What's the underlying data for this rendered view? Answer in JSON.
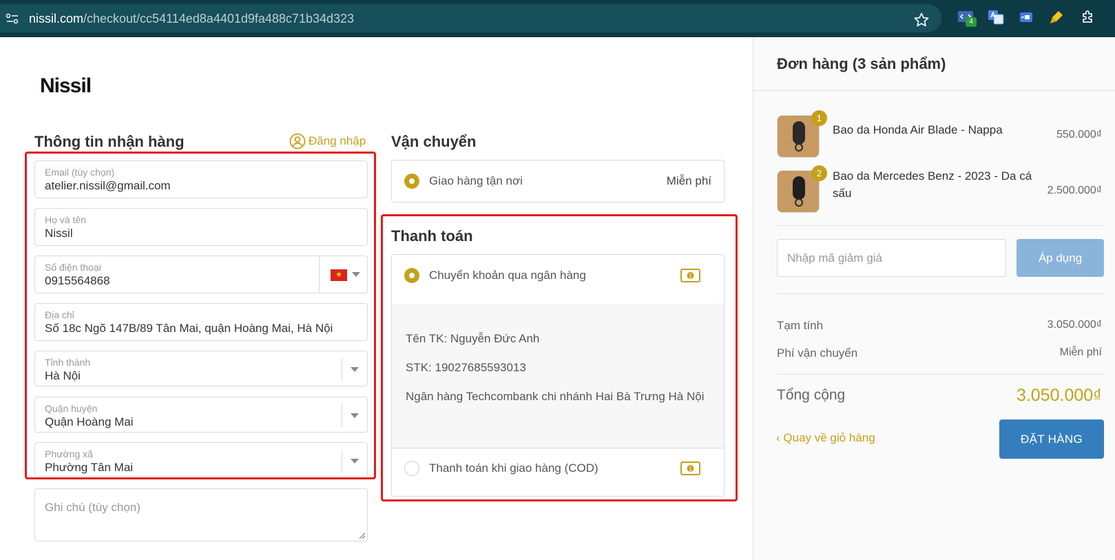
{
  "browser": {
    "url_host": "nissil.com",
    "url_path": "/checkout/cc54114ed8a4401d9fa488c71b34d323",
    "extension_badge": "4"
  },
  "logo_text": "Nissil",
  "customer": {
    "title": "Thông tin nhận hàng",
    "login_label": "Đăng nhập",
    "email": {
      "label": "Email (tùy chọn)",
      "value": "atelier.nissil@gmail.com"
    },
    "name": {
      "label": "Họ và tên",
      "value": "Nissil"
    },
    "phone": {
      "label": "Số điện thoại",
      "value": "0915564868"
    },
    "address": {
      "label": "Địa chỉ",
      "value": "Số 18c Ngõ 147B/89 Tân Mai, quận Hoàng Mai, Hà Nội"
    },
    "province": {
      "label": "Tỉnh thành",
      "value": "Hà Nội"
    },
    "district": {
      "label": "Quận huyện",
      "value": "Quận Hoàng Mai"
    },
    "ward": {
      "label": "Phường xã",
      "value": "Phường Tân Mai"
    },
    "note_placeholder": "Ghi chú (tùy chọn)"
  },
  "shipping": {
    "title": "Vận chuyển",
    "option_label": "Giao hàng tận nơi",
    "option_price": "Miễn phí"
  },
  "payment": {
    "title": "Thanh toán",
    "bank_transfer_label": "Chuyển khoản qua ngân hàng",
    "bank_account_name": "Tên TK: Nguyễn Đức Anh",
    "bank_account_number": "STK: 19027685593013",
    "bank_name": "Ngân hàng Techcombank chi nhánh Hai Bà Trưng Hà Nội",
    "cod_label": "Thanh toán khi giao hàng (COD)"
  },
  "order": {
    "title": "Đơn hàng (3 sản phẩm)",
    "items": [
      {
        "qty": "1",
        "name": "Bao da Honda Air Blade - Nappa",
        "price": "550.000₫"
      },
      {
        "qty": "2",
        "name": "Bao da Mercedes Benz - 2023 - Da cá sấu",
        "price": "2.500.000₫"
      }
    ],
    "coupon_placeholder": "Nhập mã giảm giá",
    "apply_label": "Áp dụng",
    "subtotal_label": "Tạm tính",
    "subtotal_value": "3.050.000₫",
    "shipping_fee_label": "Phí vận chuyển",
    "shipping_fee_value": "Miễn phí",
    "total_label": "Tổng cộng",
    "total_value": "3.050.000₫",
    "back_label": "Quay về giỏ hàng",
    "place_order_label": "ĐẶT HÀNG"
  },
  "colors": {
    "accent_gold": "#c5a11a",
    "order_button": "#357ebd",
    "apply_button": "#8ab4d9",
    "highlight_red": "#e31b1b",
    "browser_bar": "#0d3b45"
  }
}
